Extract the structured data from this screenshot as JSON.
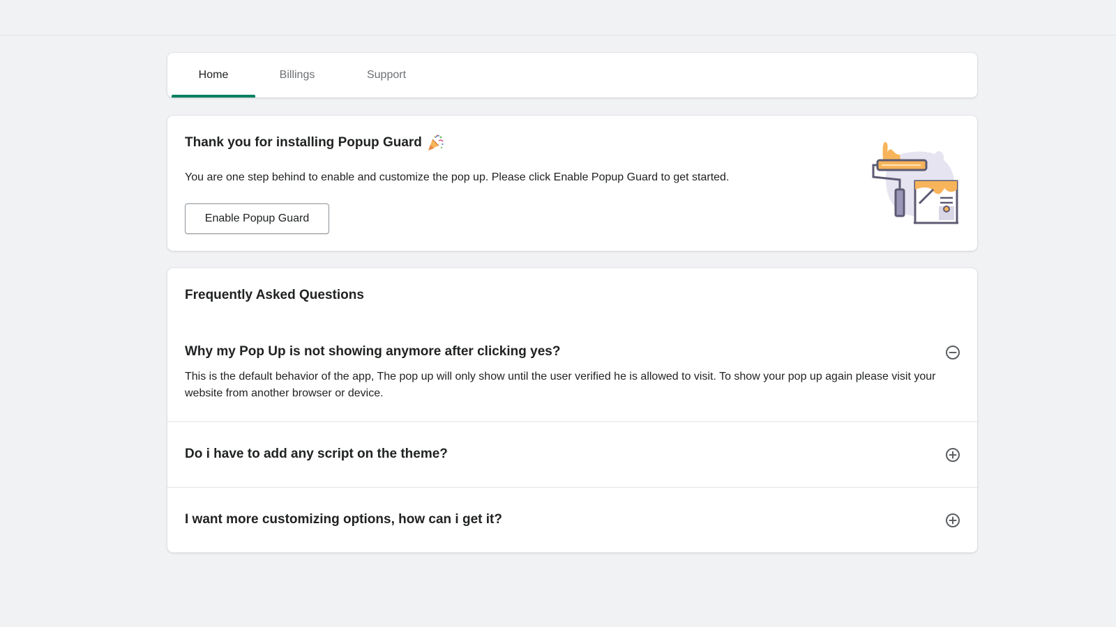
{
  "tabs": [
    {
      "label": "Home",
      "active": true
    },
    {
      "label": "Billings",
      "active": false
    },
    {
      "label": "Support",
      "active": false
    }
  ],
  "welcome": {
    "title": "Thank you for installing Popup Guard",
    "title_icon": "party-popper-icon",
    "text": "You are one step behind to enable and customize the pop up. Please click Enable Popup Guard to get started.",
    "button_label": "Enable Popup Guard",
    "illustration": "paint-roller-illustration"
  },
  "faq": {
    "heading": "Frequently Asked Questions",
    "items": [
      {
        "question": "Why my Pop Up is not showing anymore after clicking yes?",
        "answer": "This is the default behavior of the app, The pop up will only show until the user verified he is allowed to visit. To show your pop up again please visit your website from another browser or device.",
        "expanded": true,
        "toggle_icon": "minus-circle-icon"
      },
      {
        "question": "Do i have to add any script on the theme?",
        "expanded": false,
        "toggle_icon": "plus-circle-icon"
      },
      {
        "question": "I want more customizing options, how can i get it?",
        "expanded": false,
        "toggle_icon": "plus-circle-icon"
      }
    ]
  },
  "colors": {
    "accent": "#008060",
    "background": "#f1f2f4",
    "card": "#ffffff",
    "text": "#202223",
    "muted_text": "#6d7175",
    "illustration_orange": "#f7b45a",
    "illustration_purple": "#5c5a72"
  }
}
